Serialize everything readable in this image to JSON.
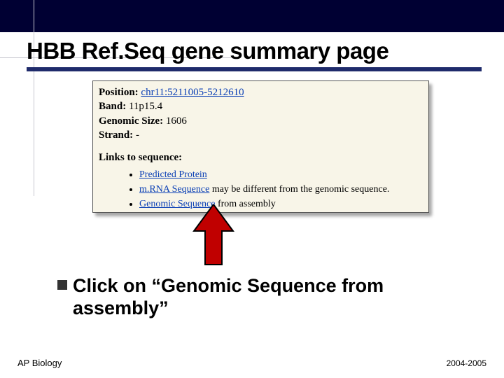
{
  "title": "HBB Ref.Seq gene summary page",
  "panel": {
    "position_label": "Position:",
    "position_value": "chr11:5211005-5212610",
    "band_label": "Band:",
    "band_value": "11p15.4",
    "size_label": "Genomic Size:",
    "size_value": "1606",
    "strand_label": "Strand:",
    "strand_value": "-",
    "links_heading": "Links to sequence:",
    "link_protein": "Predicted Protein",
    "link_mrna": "m.RNA Sequence",
    "mrna_suffix": " may be different from the genomic sequence.",
    "link_genomic": "Genomic Sequence",
    "genomic_suffix": " from assembly"
  },
  "instruction": "Click on “Genomic Sequence from assembly”",
  "footer_left": "AP Biology",
  "footer_right": "2004-2005",
  "colors": {
    "dark_bar": "#000033",
    "underline": "#1f2b6b",
    "panel_bg": "#f8f5e8",
    "link": "#0a3fb5",
    "arrow": "#c00000"
  }
}
